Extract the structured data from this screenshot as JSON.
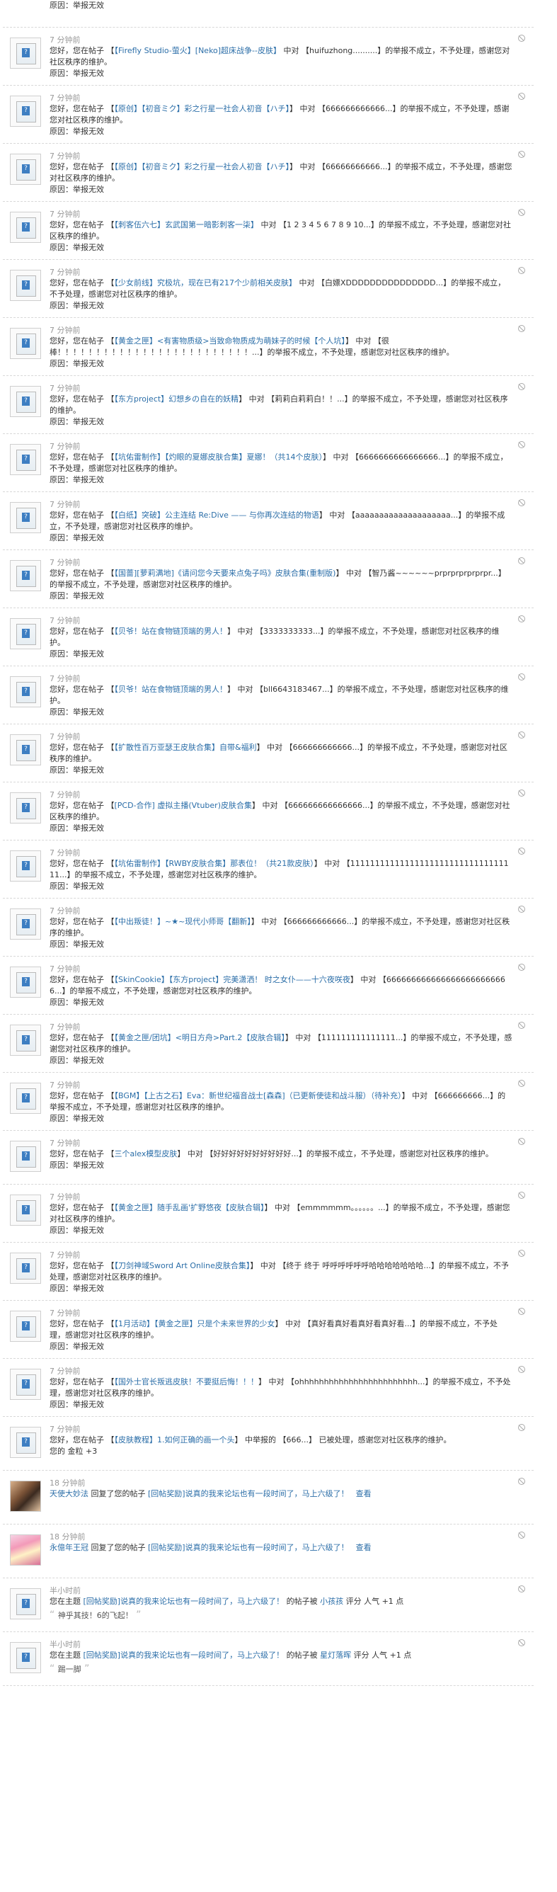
{
  "first": {
    "reason": "原因：举报无效"
  },
  "notices": [
    {
      "time": "7 分钟前",
      "pre": "您好，您在帖子 【",
      "link": "【Firefly Studio-萤火】[Neko]超床战争--皮肤】",
      "post": " 中对 【huifuzhong..........】的举报不成立，不予处理，感谢您对社区秩序的维护。",
      "reason": "原因：举报无效"
    },
    {
      "time": "7 分钟前",
      "pre": "您好，您在帖子 【",
      "link": "【原创】【初音ミク】彩之行星一社会人初音【ハチ】",
      "post": "】 中对 【666666666666...】的举报不成立，不予处理，感谢您对社区秩序的维护。",
      "reason": "原因：举报无效"
    },
    {
      "time": "7 分钟前",
      "pre": "您好，您在帖子 【",
      "link": "【原创】【初音ミク】彩之行星一社会人初音【ハチ】",
      "post": "】 中对 【66666666666...】的举报不成立，不予处理，感谢您对社区秩序的维护。",
      "reason": "原因：举报无效"
    },
    {
      "time": "7 分钟前",
      "pre": "您好，您在帖子 【",
      "link": "【刺客伍六七】玄武国第一暗影刺客一柒】",
      "post": " 中对 【1 2 3 4 5 6 7 8 9 10...】的举报不成立，不予处理，感谢您对社区秩序的维护。",
      "reason": "原因：举报无效"
    },
    {
      "time": "7 分钟前",
      "pre": "您好，您在帖子 【",
      "link": "【少女前线】究极坑，现在已有217个少前相关皮肤】",
      "post": " 中对 【白嫖XDDDDDDDDDDDDDDD...】的举报不成立，不予处理，感谢您对社区秩序的维护。",
      "reason": "原因：举报无效"
    },
    {
      "time": "7 分钟前",
      "pre": "您好，您在帖子 【",
      "link": "【黄金之匣】&lt;有害物质级&gt;当致命物质成为萌妹子的时候【个人坑】",
      "post": "】 中对 【很棒！！！！！！！！！！！！！！！！！！！！！！！！！...】的举报不成立，不予处理，感谢您对社区秩序的维护。",
      "reason": "原因：举报无效"
    },
    {
      "time": "7 分钟前",
      "pre": "您好，您在帖子 【",
      "link": "【东方project】幻想乡の自在的妖精",
      "post": "】 中对 【莉莉白莉莉白！！...】的举报不成立，不予处理，感谢您对社区秩序的维护。",
      "reason": "原因：举报无效"
    },
    {
      "time": "7 分钟前",
      "pre": "您好，您在帖子 【",
      "link": "【坑佑雷制作】【灼眼的夏娜皮肤合集】夏娜！（共14个皮肤）",
      "post": "】 中对 【6666666666666666...】的举报不成立，不予处理，感谢您对社区秩序的维护。",
      "reason": "原因：举报无效"
    },
    {
      "time": "7 分钟前",
      "pre": "您好，您在帖子 【",
      "link": "【白纸】突破】公主连结 Re:Dive —— 与你再次连结的物语",
      "post": "】 中对 【aaaaaaaaaaaaaaaaaaaa...】的举报不成立，不予处理，感谢您对社区秩序的维护。",
      "reason": "原因：举报无效"
    },
    {
      "time": "7 分钟前",
      "pre": "您好，您在帖子 【",
      "link": "【国蔷][萝莉满地]《请问您今天要来点兔子吗》皮肤合集(重制版)",
      "post": "】 中对 【智乃酱~~~~~~prprprprprprpr...】的举报不成立，不予处理，感谢您对社区秩序的维护。",
      "reason": "原因：举报无效"
    },
    {
      "time": "7 分钟前",
      "pre": "您好，您在帖子 【",
      "link": "【贝爷！站在食物链顶端的男人！",
      "post": "】 中对 【3333333333...】的举报不成立，不予处理，感谢您对社区秩序的维护。",
      "reason": "原因：举报无效"
    },
    {
      "time": "7 分钟前",
      "pre": "您好，您在帖子 【",
      "link": "【贝爷！站在食物链顶端的男人！",
      "post": "】 中对 【bll6643183467...】的举报不成立，不予处理，感谢您对社区秩序的维护。",
      "reason": "原因：举报无效"
    },
    {
      "time": "7 分钟前",
      "pre": "您好，您在帖子 【",
      "link": "【扩散性百万亚瑟王皮肤合集】自带&福利",
      "post": "】 中对 【666666666666...】的举报不成立，不予处理，感谢您对社区秩序的维护。",
      "reason": "原因：举报无效"
    },
    {
      "time": "7 分钟前",
      "pre": "您好，您在帖子 【",
      "link": "[PCD-合作] 虚拟主播(Vtuber)皮肤合集",
      "post": "】 中对 【666666666666666...】的举报不成立，不予处理，感谢您对社区秩序的维护。",
      "reason": "原因：举报无效"
    },
    {
      "time": "7 分钟前",
      "pre": "您好，您在帖子 【",
      "link": "【坑佑雷制作】【RWBY皮肤合集】那表位！（共21款皮肤）",
      "post": "】 中对 【1111111111111111111111111111111111...】的举报不成立，不予处理，感谢您对社区秩序的维护。",
      "reason": "原因：举报无效"
    },
    {
      "time": "7 分钟前",
      "pre": "您好，您在帖子 【",
      "link": "【中出叛徒！】~★~现代小师哥【翻新】",
      "post": "】 中对 【666666666666...】的举报不成立，不予处理，感谢您对社区秩序的维护。",
      "reason": "原因：举报无效"
    },
    {
      "time": "7 分钟前",
      "pre": "您好，您在帖子 【",
      "link": "【SkinCookie】【东方project】完美潇洒！ 时之女仆——十六夜咲夜",
      "post": "】 中对 【6666666666666666666666666...】的举报不成立，不予处理，感谢您对社区秩序的维护。",
      "reason": "原因：举报无效"
    },
    {
      "time": "7 分钟前",
      "pre": "您好，您在帖子 【",
      "link": "【黄金之匣/团坑】&lt;明日方舟&gt;Part.2【皮肤合辑】",
      "post": "】 中对 【111111111111111...】的举报不成立，不予处理，感谢您对社区秩序的维护。",
      "reason": "原因：举报无效"
    },
    {
      "time": "7 分钟前",
      "pre": "您好，您在帖子 【",
      "link": "【BGM】【上古之石】Eva：新世纪福音战士[森森]（已更新使徒和战斗服）（待补充）",
      "post": "】 中对 【666666666...】的举报不成立，不予处理，感谢您对社区秩序的维护。",
      "reason": "原因：举报无效"
    },
    {
      "time": "7 分钟前",
      "pre": "您好，您在帖子 【",
      "link": "三个alex模型皮肤",
      "post": "】 中对 【好好好好好好好好好好...】的举报不成立，不予处理，感谢您对社区秩序的维护。",
      "reason": "原因：举报无效"
    },
    {
      "time": "7 分钟前",
      "pre": "您好，您在帖子 【",
      "link": "【黄金之匣】随手乱画'扩野悠夜【皮肤合辑】",
      "post": "】 中对 【emmmmmm。。。。。。...】的举报不成立，不予处理，感谢您对社区秩序的维护。",
      "reason": "原因：举报无效"
    },
    {
      "time": "7 分钟前",
      "pre": "您好，您在帖子 【",
      "link": "【刀剑神域Sword Art Online皮肤合集】",
      "post": "】 中对 【终于 终于 呼呼呼呼呼呼哈哈哈哈哈哈哈...】的举报不成立，不予处理，感谢您对社区秩序的维护。",
      "reason": "原因：举报无效"
    },
    {
      "time": "7 分钟前",
      "pre": "您好，您在帖子 【",
      "link": "【1月活动】【黄金之匣】只是个未来世界的少女",
      "post": "】 中对 【真好看真好看真好看真好看...】的举报不成立，不予处理，感谢您对社区秩序的维护。",
      "reason": "原因：举报无效"
    },
    {
      "time": "7 分钟前",
      "pre": "您好，您在帖子 【",
      "link": "【国外士官长叛逃皮肤！不要挺后悔！！！",
      "post": "】 中对 【ohhhhhhhhhhhhhhhhhhhhhhhh...】的举报不成立，不予处理，感谢您对社区秩序的维护。",
      "reason": "原因：举报无效"
    }
  ],
  "rating": {
    "time": "7 分钟前",
    "pre": "您好，您在帖子 【",
    "link": "【皮肤教程】1.如何正确的画一个头",
    "post": "】 中举报的 【666...】 已被处理，感谢您对社区秩序的维护。",
    "reason": "您的 金粒 +3"
  },
  "replies": [
    {
      "time": "18 分钟前",
      "user": "天使大妙法",
      "text": " 回复了您的帖子 ",
      "link": "[回帖奖励]说真的我来论坛也有一段时间了，马上六级了！",
      "view": "查看"
    },
    {
      "time": "18 分钟前",
      "user": "永億年王冠",
      "text": " 回复了您的帖子 ",
      "link": "[回帖奖励]说真的我来论坛也有一段时间了，马上六级了！",
      "view": "查看"
    }
  ],
  "rates": [
    {
      "time": "半小时前",
      "pre": "您在主题 ",
      "link": "[回帖奖励]说真的我来论坛也有一段时间了，马上六级了！",
      "mid": " 的帖子被 ",
      "user": "小孩孩",
      "post": " 评分 人气 +1 点",
      "quote": "神乎其技！6的飞起！"
    },
    {
      "time": "半小时前",
      "pre": "您在主题 ",
      "link": "[回帖奖励]说真的我来论坛也有一段时间了，马上六级了！",
      "mid": " 的帖子被 ",
      "user": "星灯落晖",
      "post": " 评分 人气 +1 点",
      "quote": "踢一脚"
    }
  ]
}
